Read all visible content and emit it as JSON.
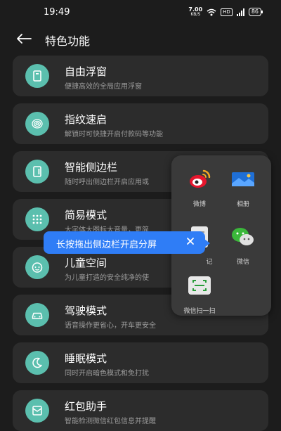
{
  "status": {
    "time": "19:49",
    "net_speed": "7.00",
    "net_unit": "KB/S",
    "hd_badge": "HD",
    "battery": "86"
  },
  "header": {
    "title": "特色功能"
  },
  "features": [
    {
      "title": "自由浮窗",
      "subtitle": "便捷高效的全局应用浮窗",
      "icon": "floating-window-icon"
    },
    {
      "title": "指纹速启",
      "subtitle": "解锁时可快捷开启付款码等功能",
      "icon": "fingerprint-icon"
    },
    {
      "title": "智能侧边栏",
      "subtitle": "随时呼出侧边栏开启应用或",
      "icon": "sidebar-icon"
    },
    {
      "title": "简易模式",
      "subtitle": "大字体大图标大音量，更简",
      "icon": "grid-dots-icon"
    },
    {
      "title": "儿童空间",
      "subtitle": "为儿童打造的安全纯净的使",
      "icon": "child-face-icon"
    },
    {
      "title": "驾驶模式",
      "subtitle": "语音操作更省心，开车更安全",
      "icon": "car-icon"
    },
    {
      "title": "睡眠模式",
      "subtitle": "同时开启暗色模式和免打扰",
      "icon": "moon-icon"
    },
    {
      "title": "红包助手",
      "subtitle": "智能检测微信红包信息并提醒",
      "icon": "envelope-icon"
    }
  ],
  "sidebar_panel": {
    "apps": [
      {
        "label": "微博",
        "icon": "weibo-icon"
      },
      {
        "label": "相册",
        "icon": "gallery-icon"
      },
      {
        "label": "记",
        "icon": "notes-icon"
      },
      {
        "label": "微信",
        "icon": "wechat-icon"
      },
      {
        "label": "微信扫一扫",
        "icon": "wechat-scan-icon"
      }
    ]
  },
  "tooltip": {
    "text": "长按拖出侧边栏开启分屏"
  },
  "colors": {
    "background": "#1c1c1c",
    "card": "#2c2c2c",
    "accent": "#5bbfae",
    "tooltip": "#2f7df6"
  }
}
